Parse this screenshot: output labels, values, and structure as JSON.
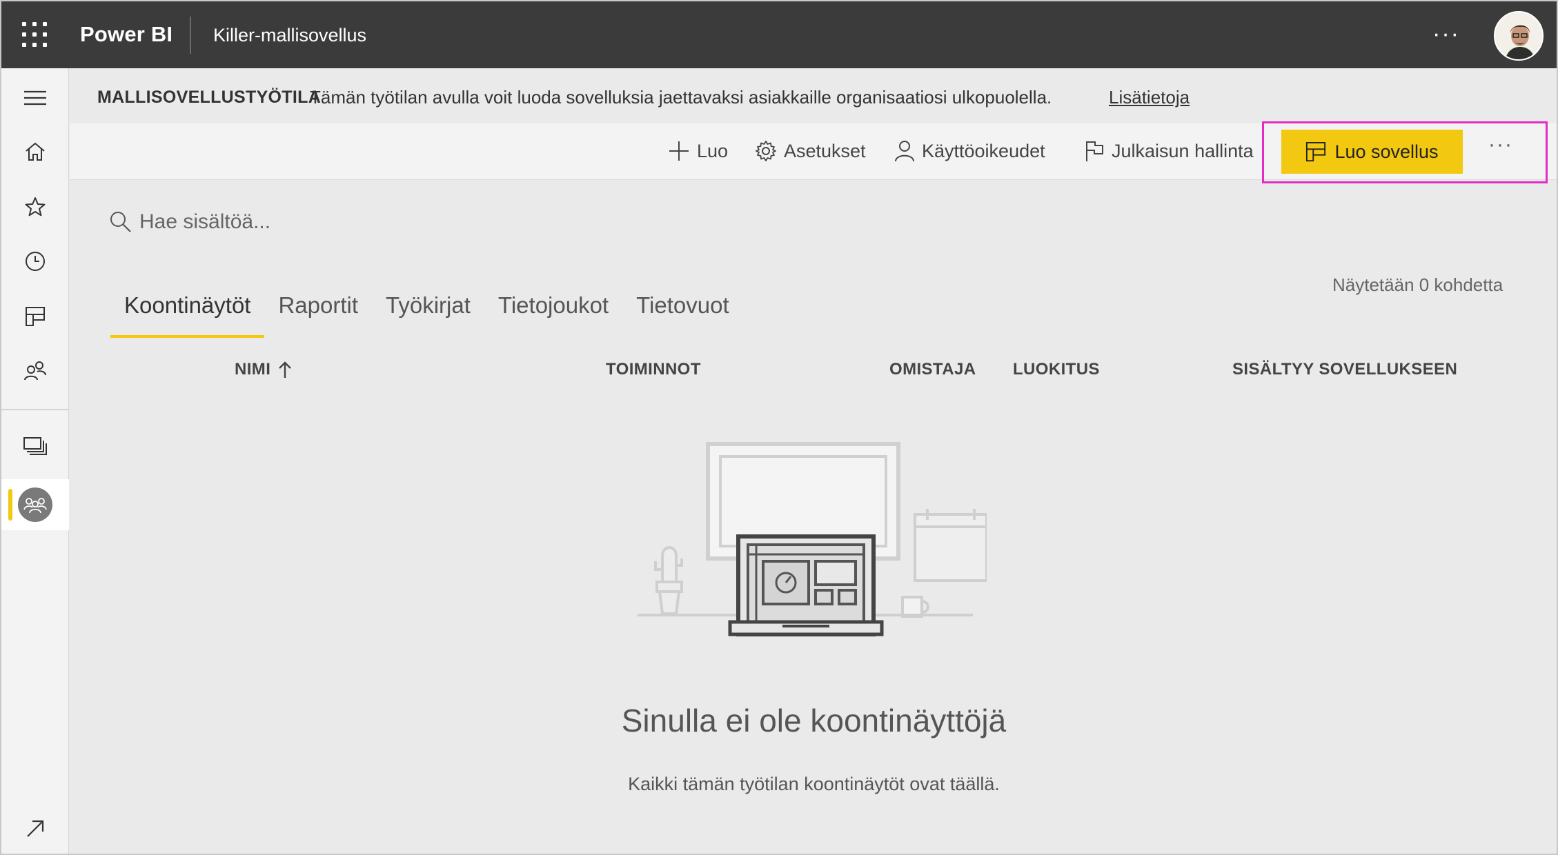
{
  "topbar": {
    "brand": "Power BI",
    "workspace_title": "Killer-mallisovellus",
    "more": "···"
  },
  "leftnav": {
    "items": [
      {
        "icon": "menu-icon"
      },
      {
        "icon": "home-icon"
      },
      {
        "icon": "star-icon"
      },
      {
        "icon": "clock-icon"
      },
      {
        "icon": "apps-icon"
      },
      {
        "icon": "shared-icon"
      },
      {
        "icon": "workspaces-icon"
      },
      {
        "icon": "workspace-people-icon"
      },
      {
        "icon": "expand-arrow-icon"
      }
    ],
    "accent_color": "#f2c811"
  },
  "banner": {
    "label": "MALLISOVELLUSTYÖTILA",
    "text": "Tämän työtilan avulla voit luoda sovelluksia jaettavaksi asiakkaille organisaatiosi ulkopuolella.",
    "link": "Lisätietoja"
  },
  "toolbar": {
    "create": "Luo",
    "settings": "Asetukset",
    "access": "Käyttöoikeudet",
    "release_mgmt": "Julkaisun hallinta",
    "create_app": "Luo sovellus",
    "more": "···",
    "create_app_color": "#f2c811",
    "highlight_color": "#e32bc6"
  },
  "search": {
    "placeholder": "Hae sisältöä..."
  },
  "showing_count": "Näytetään 0 kohdetta",
  "tabs": [
    {
      "label": "Koontinäytöt",
      "active": true
    },
    {
      "label": "Raportit"
    },
    {
      "label": "Työkirjat"
    },
    {
      "label": "Tietojoukot"
    },
    {
      "label": "Tietovuot"
    }
  ],
  "columns": {
    "name": "NIMI",
    "actions": "TOIMINNOT",
    "owner": "OMISTAJA",
    "classification": "LUOKITUS",
    "included_in_app": "SISÄLTYY SOVELLUKSEEN"
  },
  "empty_state": {
    "title": "Sinulla ei ole koontinäyttöjä",
    "subtitle": "Kaikki tämän työtilan koontinäytöt ovat täällä."
  }
}
